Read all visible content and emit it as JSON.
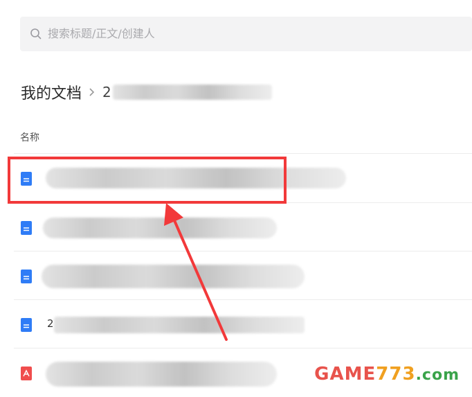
{
  "search": {
    "placeholder": "搜索标题/正文/创建人"
  },
  "breadcrumb": {
    "root": "我的文档",
    "current": "2"
  },
  "list": {
    "column_name": "名称",
    "rows": [
      {
        "type": "doc",
        "name": ""
      },
      {
        "type": "doc",
        "name": ""
      },
      {
        "type": "doc",
        "name": ""
      },
      {
        "type": "doc",
        "name": "2"
      },
      {
        "type": "pdf",
        "name": ""
      }
    ]
  },
  "watermark": {
    "game": "GAME",
    "num": "773",
    "com": ".com"
  },
  "colors": {
    "doc_icon": "#2f7cf6",
    "pdf_icon": "#f04d4d",
    "highlight": "#f2393a"
  }
}
